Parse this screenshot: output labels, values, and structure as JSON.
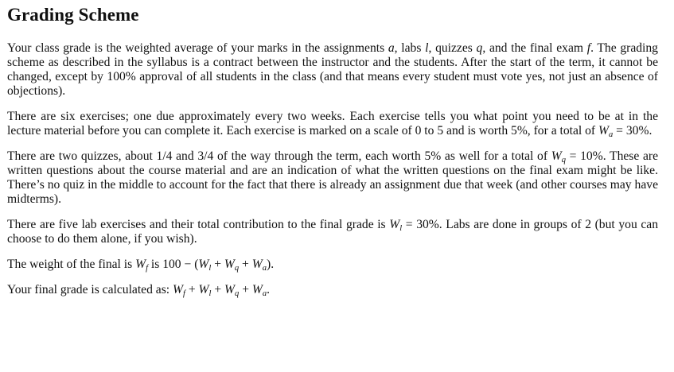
{
  "title": "Grading Scheme",
  "paragraphs": [
    {
      "segments": [
        {
          "text": "Your class grade is the weighted average of your marks in the assignments "
        },
        {
          "var": "a"
        },
        {
          "text": ", labs "
        },
        {
          "var": "l"
        },
        {
          "text": ", quizzes "
        },
        {
          "var": "q"
        },
        {
          "text": ", and the final exam "
        },
        {
          "var": "f"
        },
        {
          "text": ". The grading scheme as described in the syllabus is a contract between the instructor and the students. After the start of the term, it cannot be changed, except by 100% approval of all students in the class (and that means every student must vote yes, not just an absence of objections)."
        }
      ]
    },
    {
      "segments": [
        {
          "text": "There are six exercises; one due approximately every two weeks. Each exercise tells you what point you need to be at in the lecture material before you can complete it. Each exercise is marked on a scale of 0 to 5 and is worth 5%, for a total of "
        },
        {
          "var": "W",
          "sub": "a"
        },
        {
          "math": " = 30%"
        },
        {
          "text": "."
        }
      ]
    },
    {
      "segments": [
        {
          "text": "There are two quizzes, about 1/4 and 3/4 of the way through the term, each worth 5% as well for a total of "
        },
        {
          "var": "W",
          "sub": "q"
        },
        {
          "math": " = 10%"
        },
        {
          "text": ". These are written questions about the course material and are an indication of what the written questions on the final exam might be like. There’s no quiz in the middle to account for the fact that there is already an assignment due that week (and other courses may have midterms)."
        }
      ]
    },
    {
      "segments": [
        {
          "text": "There are five lab exercises and their total contribution to the final grade is "
        },
        {
          "var": "W",
          "sub": "l"
        },
        {
          "math": " = 30%"
        },
        {
          "text": ". Labs are done in groups of 2 (but you can choose to do them alone, if you wish)."
        }
      ]
    },
    {
      "segments": [
        {
          "text": "The weight of the final is "
        },
        {
          "var": "W",
          "sub": "f"
        },
        {
          "text": " is 100 − ("
        },
        {
          "var": "W",
          "sub": "l"
        },
        {
          "math": " + "
        },
        {
          "var": "W",
          "sub": "q"
        },
        {
          "math": " + "
        },
        {
          "var": "W",
          "sub": "a"
        },
        {
          "text": ")."
        }
      ]
    },
    {
      "segments": [
        {
          "text": "Your final grade is calculated as: "
        },
        {
          "var": "W",
          "sub": "f"
        },
        {
          "math": " + "
        },
        {
          "var": "W",
          "sub": "l"
        },
        {
          "math": " + "
        },
        {
          "var": "W",
          "sub": "q"
        },
        {
          "math": " + "
        },
        {
          "var": "W",
          "sub": "a"
        },
        {
          "text": "."
        }
      ]
    }
  ]
}
